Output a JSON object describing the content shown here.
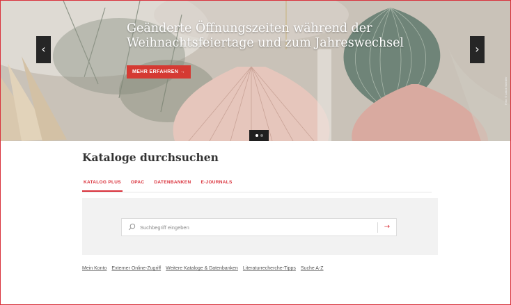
{
  "hero": {
    "title": "Geänderte Öffnungszeiten während der Weihnachtsfeiertage und zum Jahreswechsel",
    "button_label": "MEHR ERFAHREN →",
    "prev_glyph": "‹",
    "next_glyph": "›",
    "slides_total": 2,
    "slide_active": 1,
    "credit": "Foto: © Jakob Maedler"
  },
  "catalog": {
    "title": "Kataloge durchsuchen",
    "tabs": [
      {
        "label": "KATALOG PLUS",
        "active": true
      },
      {
        "label": "OPAC",
        "active": false
      },
      {
        "label": "DATENBANKEN",
        "active": false
      },
      {
        "label": "E-JOURNALS",
        "active": false
      }
    ],
    "search": {
      "placeholder": "Suchbegriff eingeben",
      "submit_glyph": "→",
      "icon": "search-icon"
    },
    "links": [
      "Mein Konto",
      "Externer Online-Zugriff",
      "Weitere Kataloge & Datenbanken",
      "Literaturrecherche-Tipps",
      "Suche A-Z"
    ]
  },
  "colors": {
    "accent": "#d9303a",
    "panel": "#f2f2f2",
    "arrow_bg": "#262626"
  }
}
